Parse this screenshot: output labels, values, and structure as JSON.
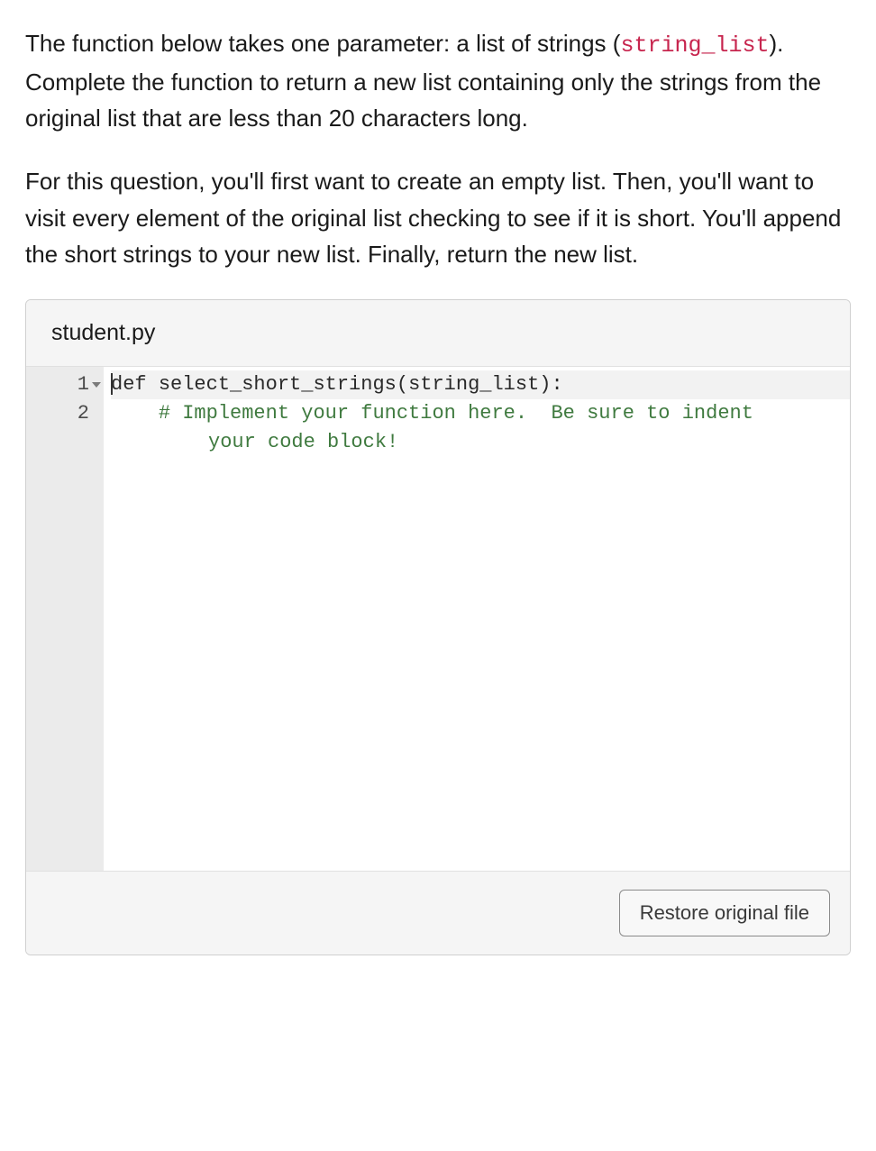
{
  "instructions": {
    "para1_pre": "The function below takes one parameter: a list of strings (",
    "para1_code": "string_list",
    "para1_post": "). Complete the function to return a new list containing only the strings from the original list that are less than 20 characters long.",
    "para2": "For this question, you'll first want to create an empty list. Then, you'll want to visit every element of the original list checking to see if it is short. You'll append the short strings to your new list. Finally, return the new list."
  },
  "editor": {
    "filename": "student.py",
    "gutter": [
      "1",
      "2"
    ],
    "code": {
      "line1": {
        "kw": "def",
        "space": " ",
        "name": "select_short_strings",
        "paren_open": "(",
        "param": "string_list",
        "paren_close_colon": "):"
      },
      "line2": {
        "indent": "    ",
        "comment_a": "# Implement your function here.  Be sure to indent ",
        "comment_b": "your code block!"
      }
    },
    "restore_label": "Restore original file"
  }
}
